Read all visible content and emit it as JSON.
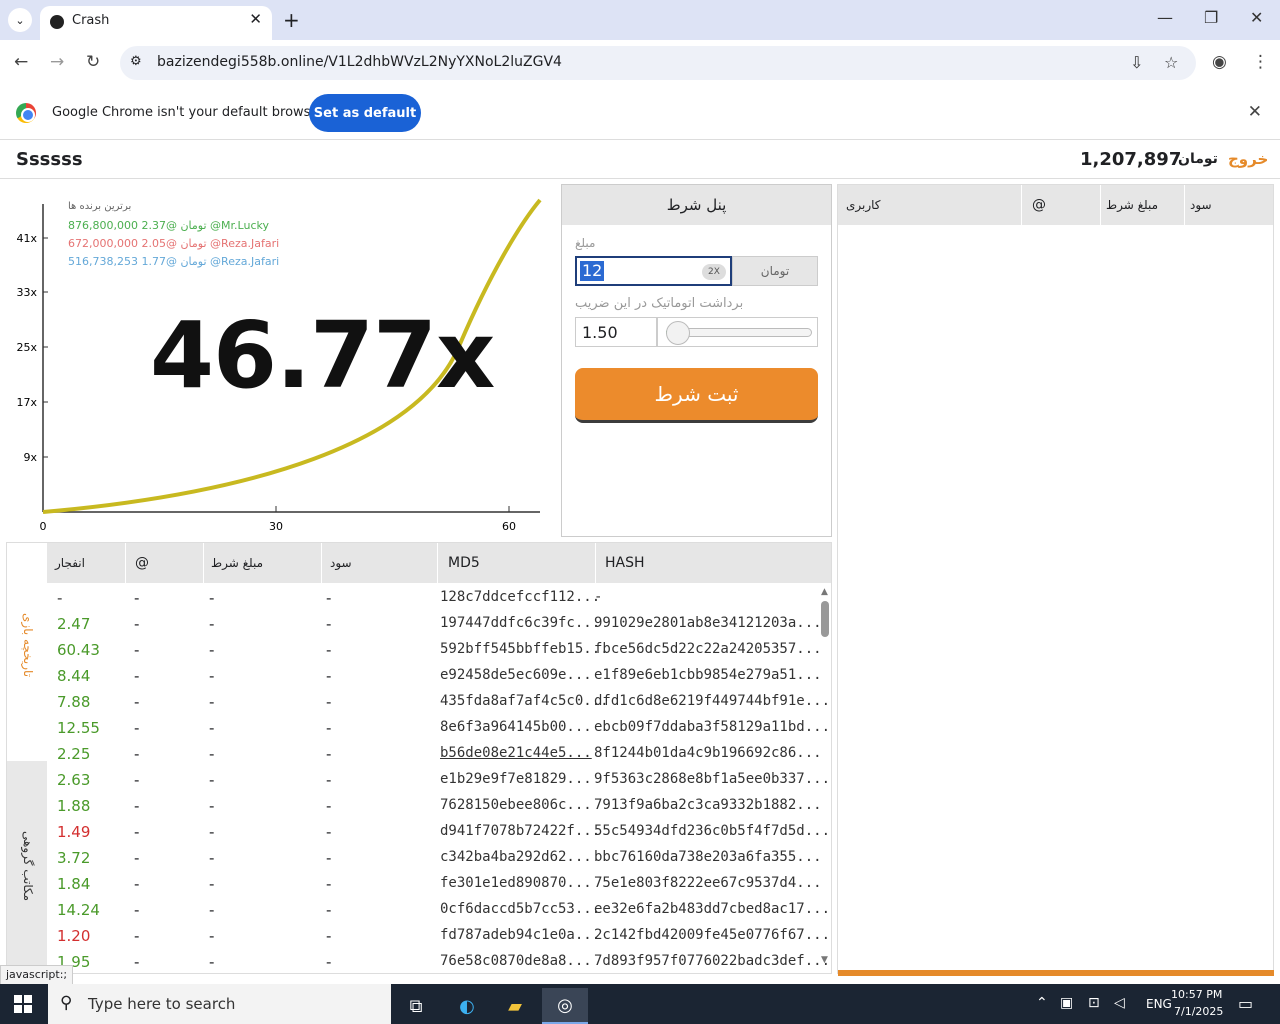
{
  "browser": {
    "tab_title": "Crash",
    "url": "bazizendegi558b.online/V1L2dhbWVzL2NyYXNoL2luZGV4",
    "infobar_message": "Google Chrome isn't your default browser",
    "set_default_label": "Set as default"
  },
  "header": {
    "username": "Ssssss",
    "balance": "1,207,897",
    "currency": "تومان",
    "exit_label": "خروج"
  },
  "game": {
    "multiplier": "46.77x",
    "leaders_title": "برترین برنده ها",
    "leaders": [
      {
        "text": "876,800,000 2.37@ تومان @Mr.Lucky",
        "color": "#4caf50"
      },
      {
        "text": "672,000,000 2.05@ تومان @Reza.Jafari",
        "color": "#e57373"
      },
      {
        "text": "516,738,253 1.77@ تومان @Reza.Jafari",
        "color": "#64a8d8"
      }
    ],
    "y_ticks": [
      "41x",
      "33x",
      "25x",
      "17x",
      "9x"
    ],
    "x_ticks": [
      "0",
      "30",
      "60"
    ],
    "curve_color": "#c8b920"
  },
  "bet_panel": {
    "title": "پنل شرط",
    "amount_label": "مبلغ",
    "amount_value": "12",
    "double_label": "2X",
    "currency": "تومان",
    "auto_label": "برداشت اتوماتیک در این ضریب",
    "auto_value": "1.50",
    "submit_label": "ثبت شرط"
  },
  "users_table": {
    "headers": [
      "سود",
      "مبلغ شرط",
      "@",
      "کاربری"
    ]
  },
  "history": {
    "side_tabs": [
      "تاریخچه بازی",
      "مکاتب گروهی"
    ],
    "headers": [
      "انفجار",
      "@",
      "مبلغ شرط",
      "سود",
      "MD5",
      "HASH"
    ],
    "rows": [
      {
        "crash": "-",
        "at": "-",
        "bet": "-",
        "profit": "-",
        "md5": "128c7ddcefccf112...",
        "hash": "-",
        "color": "#333"
      },
      {
        "crash": "2.47",
        "at": "-",
        "bet": "-",
        "profit": "-",
        "md5": "197447ddfc6c39fc...",
        "hash": "991029e2801ab8e34121203a...",
        "color": "#4a9a2a"
      },
      {
        "crash": "60.43",
        "at": "-",
        "bet": "-",
        "profit": "-",
        "md5": "592bff545bbffeb15...",
        "hash": "fbce56dc5d22c22a24205357...",
        "color": "#4a9a2a"
      },
      {
        "crash": "8.44",
        "at": "-",
        "bet": "-",
        "profit": "-",
        "md5": "e92458de5ec609e...",
        "hash": "e1f89e6eb1cbb9854e279a51...",
        "color": "#4a9a2a"
      },
      {
        "crash": "7.88",
        "at": "-",
        "bet": "-",
        "profit": "-",
        "md5": "435fda8af7af4c5c0...",
        "hash": "dfd1c6d8e6219f449744bf91e...",
        "color": "#4a9a2a"
      },
      {
        "crash": "12.55",
        "at": "-",
        "bet": "-",
        "profit": "-",
        "md5": "8e6f3a964145b00...",
        "hash": "ebcb09f7ddaba3f58129a11bd...",
        "color": "#4a9a2a"
      },
      {
        "crash": "2.25",
        "at": "-",
        "bet": "-",
        "profit": "-",
        "md5": "b56de08e21c44e5...",
        "hash": "8f1244b01da4c9b196692c86...",
        "color": "#4a9a2a"
      },
      {
        "crash": "2.63",
        "at": "-",
        "bet": "-",
        "profit": "-",
        "md5": "e1b29e9f7e81829...",
        "hash": "9f5363c2868e8bf1a5ee0b337...",
        "color": "#4a9a2a"
      },
      {
        "crash": "1.88",
        "at": "-",
        "bet": "-",
        "profit": "-",
        "md5": "7628150ebee806c...",
        "hash": "7913f9a6ba2c3ca9332b1882...",
        "color": "#4a9a2a"
      },
      {
        "crash": "1.49",
        "at": "-",
        "bet": "-",
        "profit": "-",
        "md5": "d941f7078b72422f...",
        "hash": "55c54934dfd236c0b5f4f7d5d...",
        "color": "#d32f2f"
      },
      {
        "crash": "3.72",
        "at": "-",
        "bet": "-",
        "profit": "-",
        "md5": "c342ba4ba292d62...",
        "hash": "bbc76160da738e203a6fa355...",
        "color": "#4a9a2a"
      },
      {
        "crash": "1.84",
        "at": "-",
        "bet": "-",
        "profit": "-",
        "md5": "fe301e1ed890870...",
        "hash": "75e1e803f8222ee67c9537d4...",
        "color": "#4a9a2a"
      },
      {
        "crash": "14.24",
        "at": "-",
        "bet": "-",
        "profit": "-",
        "md5": "0cf6daccd5b7cc53...",
        "hash": "ee32e6fa2b483dd7cbed8ac17...",
        "color": "#4a9a2a"
      },
      {
        "crash": "1.20",
        "at": "-",
        "bet": "-",
        "profit": "-",
        "md5": "fd787adeb94c1e0a...",
        "hash": "2c142fbd42009fe45e0776f67...",
        "color": "#d32f2f"
      },
      {
        "crash": "1.95",
        "at": "-",
        "bet": "-",
        "profit": "-",
        "md5": "76e58c0870de8a8...",
        "hash": "7d893f957f0776022badc3def...",
        "color": "#4a9a2a"
      }
    ]
  },
  "status_bar": "javascript:;",
  "taskbar": {
    "search_placeholder": "Type here to search",
    "lang": "ENG",
    "time": "10:57 PM",
    "date": "7/1/2025"
  }
}
